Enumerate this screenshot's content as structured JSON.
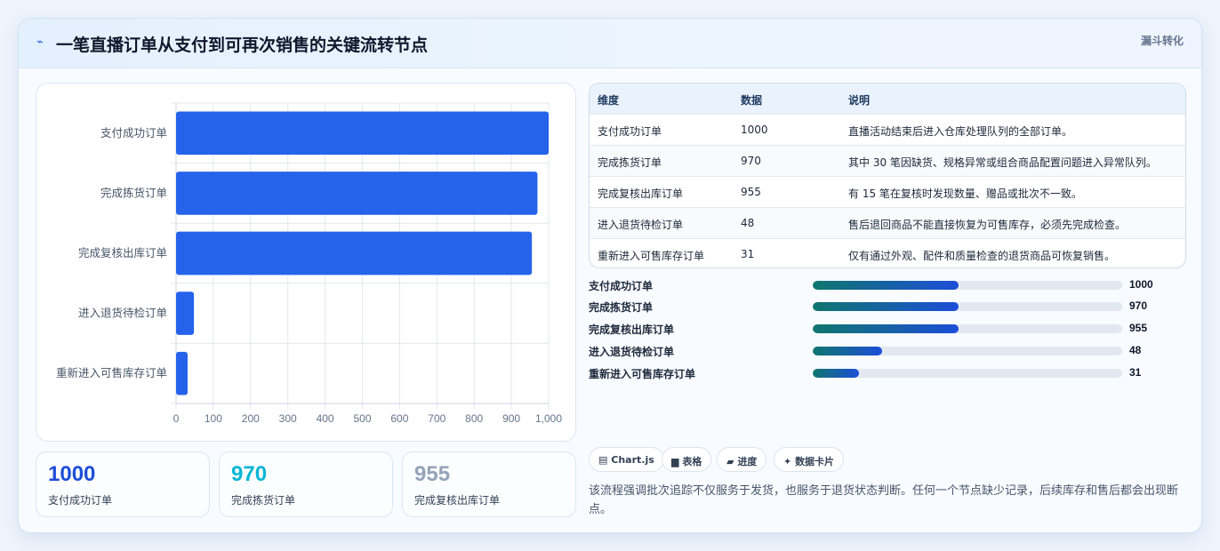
{
  "header": {
    "icon": "lightning-icon",
    "title": "一笔直播订单从支付到可再次销售的关键流转节点",
    "tag": "漏斗转化"
  },
  "chart_data": {
    "type": "bar",
    "orientation": "horizontal",
    "categories": [
      "支付成功订单",
      "完成拣货订单",
      "完成复核出库订单",
      "进入退货待检订单",
      "重新进入可售库存订单"
    ],
    "values": [
      1000,
      970,
      955,
      48,
      31
    ],
    "xlim": [
      0,
      1000
    ],
    "xticks": [
      "0",
      "100",
      "200",
      "300",
      "400",
      "500",
      "600",
      "700",
      "800",
      "900",
      "1,000"
    ],
    "grid": true,
    "color": "#2563eb"
  },
  "stats": [
    {
      "value": "1000",
      "label": "支付成功订单",
      "color": "#1d4ed8"
    },
    {
      "value": "970",
      "label": "完成拣货订单",
      "color": "#06b6d4"
    },
    {
      "value": "955",
      "label": "完成复核出库订单",
      "color": "#94a3b8"
    }
  ],
  "table": {
    "headers": [
      "维度",
      "数据",
      "说明"
    ],
    "rows": [
      [
        "支付成功订单",
        "1000",
        "直播活动结束后进入仓库处理队列的全部订单。"
      ],
      [
        "完成拣货订单",
        "970",
        "其中 30 笔因缺货、规格异常或组合商品配置问题进入异常队列。"
      ],
      [
        "完成复核出库订单",
        "955",
        "有 15 笔在复核时发现数量、赠品或批次不一致。"
      ],
      [
        "进入退货待检订单",
        "48",
        "售后退回商品不能直接恢复为可售库存，必须先完成检查。"
      ],
      [
        "重新进入可售库存订单",
        "31",
        "仅有通过外观、配件和质量检查的退货商品可恢复销售。"
      ]
    ]
  },
  "progress": [
    {
      "label": "支付成功订单",
      "value": "1000",
      "fraction": 0.47
    },
    {
      "label": "完成拣货订单",
      "value": "970",
      "fraction": 0.47
    },
    {
      "label": "完成复核出库订单",
      "value": "955",
      "fraction": 0.47
    },
    {
      "label": "进入退货待检订单",
      "value": "48",
      "fraction": 0.225
    },
    {
      "label": "重新进入可售库存订单",
      "value": "31",
      "fraction": 0.148
    }
  ],
  "chips": [
    {
      "icon": "chart-icon",
      "glyph": "▤",
      "label": "Chart.js"
    },
    {
      "icon": "table-icon",
      "glyph": "▆",
      "label": "表格"
    },
    {
      "icon": "progress-icon",
      "glyph": "▰",
      "label": "进度"
    },
    {
      "icon": "card-icon",
      "glyph": "✦",
      "label": "数据卡片"
    }
  ],
  "note": "该流程强调批次追踪不仅服务于发货，也服务于退货状态判断。任何一个节点缺少记录，后续库存和售后都会出现断点。"
}
